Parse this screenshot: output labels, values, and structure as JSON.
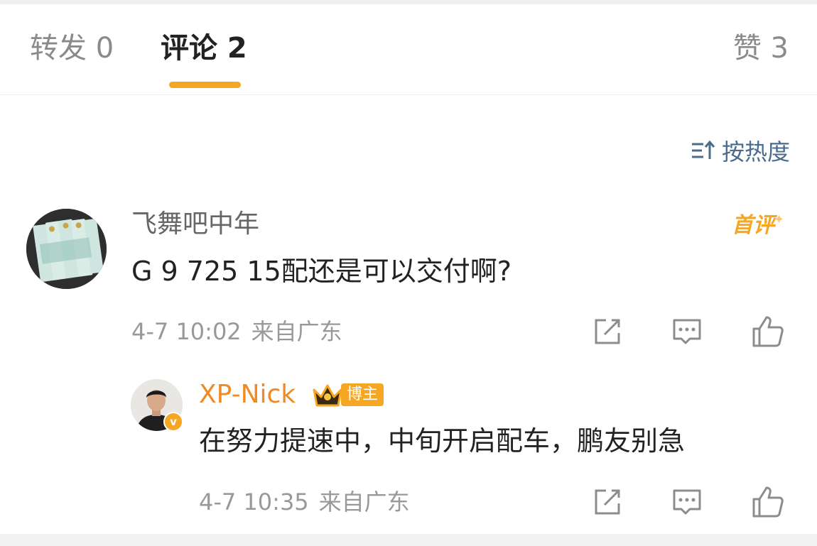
{
  "tabs": {
    "forward": "转发 0",
    "comments": "评论 2",
    "likes": "赞 3",
    "active": "comments",
    "accent_color": "#f5a623"
  },
  "sort": {
    "label": "按热度",
    "icon": "sort-icon"
  },
  "comments": [
    {
      "username": "飞舞吧中年",
      "badge": "首评",
      "text": "G 9 725 15配还是可以交付啊?",
      "time": "4-7 10:02",
      "location": "来自广东",
      "actions": [
        "share-icon",
        "comment-icon",
        "like-icon"
      ],
      "replies": [
        {
          "username": "XP-Nick",
          "role_badge": "博主",
          "role_icon": "crown-icon",
          "verified": "v",
          "text": "在努力提速中，中旬开启配车，鹏友别急",
          "time": "4-7 10:35",
          "location": "来自广东",
          "actions": [
            "share-icon",
            "comment-icon",
            "like-icon"
          ]
        }
      ]
    }
  ]
}
